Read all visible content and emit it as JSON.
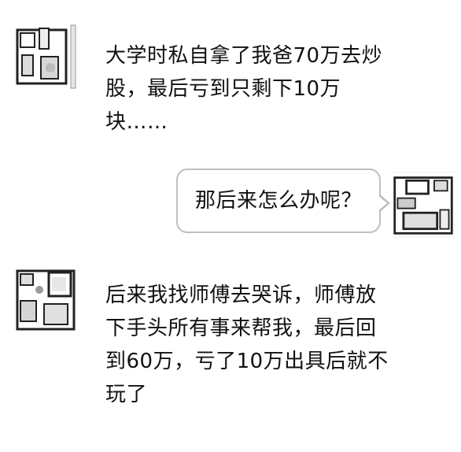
{
  "messages": [
    {
      "side": "left",
      "avatar_icon": "room-floorplan-avatar-icon",
      "lines": [
        "大学时私自拿了我爸70万去炒",
        "股，最后亏到只剩下10万",
        "块……"
      ]
    },
    {
      "side": "right",
      "avatar_icon": "room-floorplan-avatar-icon",
      "lines": [
        "那后来怎么办呢？"
      ]
    },
    {
      "side": "left",
      "avatar_icon": "room-floorplan-avatar-icon",
      "lines": [
        "后来我找师傅去哭诉，师傅放",
        "下手头所有事来帮我，最后回",
        "到60万，亏了10万出具后就不",
        "玩了"
      ]
    }
  ],
  "colors": {
    "bubble_border": "#bfbfbf",
    "text": "#111111"
  }
}
